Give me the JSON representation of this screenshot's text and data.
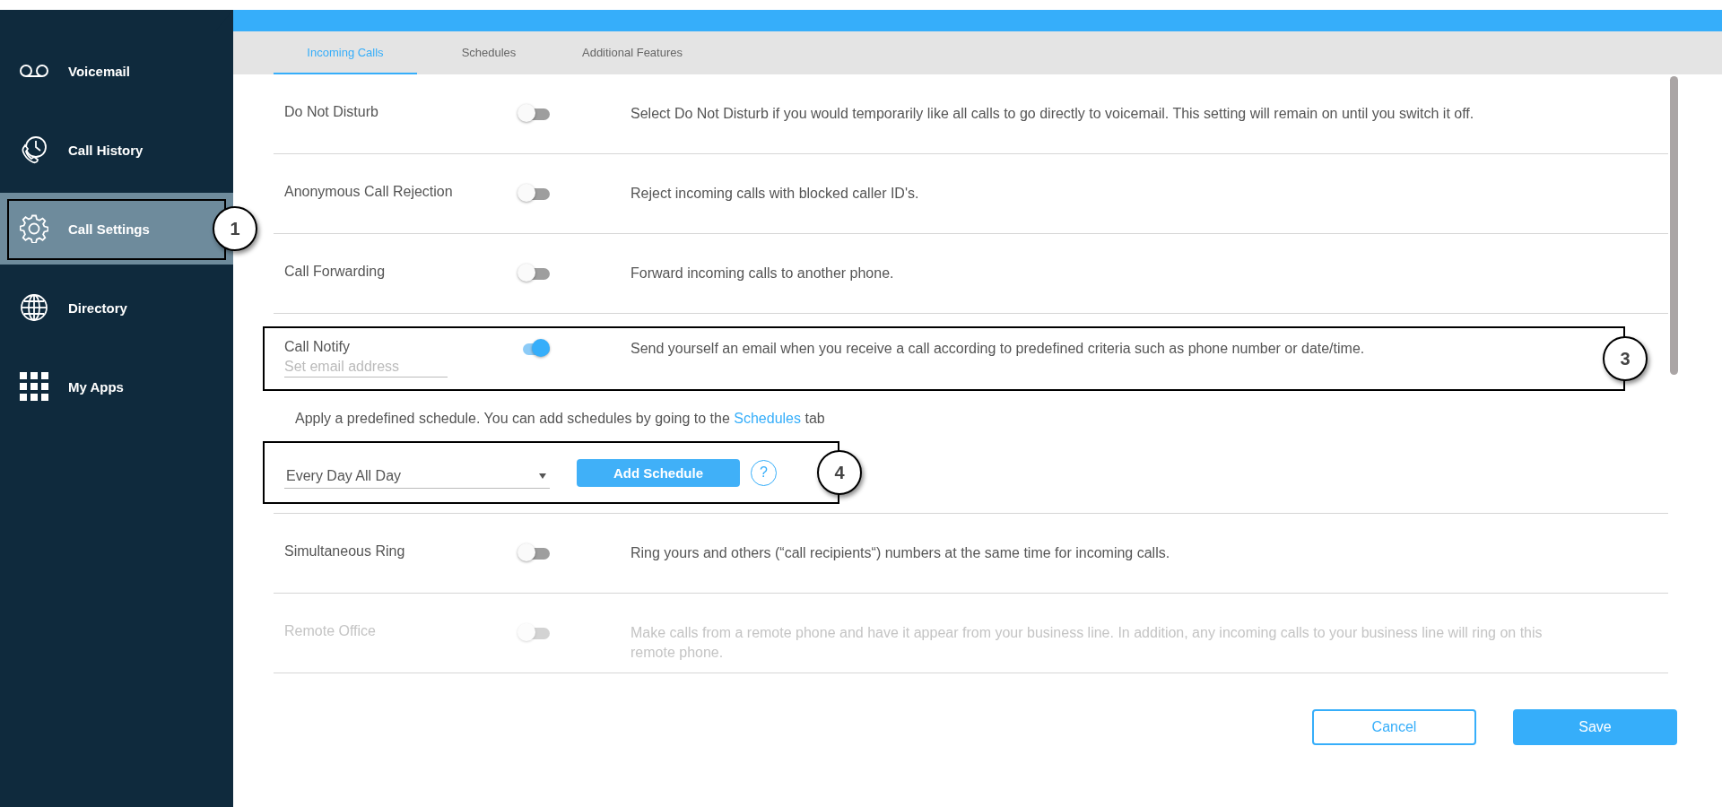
{
  "sidebar": {
    "items": [
      {
        "label": "Voicemail",
        "selected": false
      },
      {
        "label": "Call History",
        "selected": false
      },
      {
        "label": "Call Settings",
        "selected": true,
        "callout": "1"
      },
      {
        "label": "Directory",
        "selected": false
      },
      {
        "label": "My Apps",
        "selected": false
      }
    ]
  },
  "tabs": [
    {
      "label": "Incoming Calls",
      "selected": true
    },
    {
      "label": "Schedules",
      "selected": false
    },
    {
      "label": "Additional Features",
      "selected": false
    }
  ],
  "settings": [
    {
      "kind": "toggle",
      "label": "Do Not Disturb",
      "on": false,
      "disabled": false,
      "description": "Select Do Not Disturb if you would temporarily like all calls to go directly to voicemail. This setting will remain on until you switch it off."
    },
    {
      "kind": "toggle",
      "label": "Anonymous Call Rejection",
      "on": false,
      "disabled": false,
      "description": "Reject incoming calls with blocked caller ID's."
    },
    {
      "kind": "toggle",
      "label": "Call Forwarding",
      "on": false,
      "disabled": false,
      "description": "Forward incoming calls to another phone."
    },
    {
      "kind": "toggle",
      "label": "Call Notify",
      "on": true,
      "disabled": false,
      "description": "Send yourself an email when you receive a call according to predefined criteria such as phone number or date/time.",
      "email_field": {
        "placeholder": "Set email address"
      },
      "callout": "3"
    },
    {
      "kind": "schedule",
      "note": "Apply a predefined schedule. You can add schedules by going to the",
      "link": "Schedules",
      "note_end": "tab",
      "dropdown": "Every Day All Day",
      "button": "Add Schedule",
      "help": "?",
      "callout": "4"
    },
    {
      "kind": "toggle",
      "label": "Simultaneous Ring",
      "on": false,
      "disabled": false,
      "description": "Ring yours and others (“call recipients“) numbers at the same time for incoming calls."
    },
    {
      "kind": "toggle",
      "label": "Remote Office",
      "on": false,
      "disabled": true,
      "description": "Make calls from a remote phone and have it appear from your business line. In addition, any incoming calls to your business line will ring on this remote phone."
    }
  ],
  "buttons": [
    {
      "label": "Cancel",
      "kind": "secondary"
    },
    {
      "label": "Save",
      "kind": "primary"
    }
  ]
}
